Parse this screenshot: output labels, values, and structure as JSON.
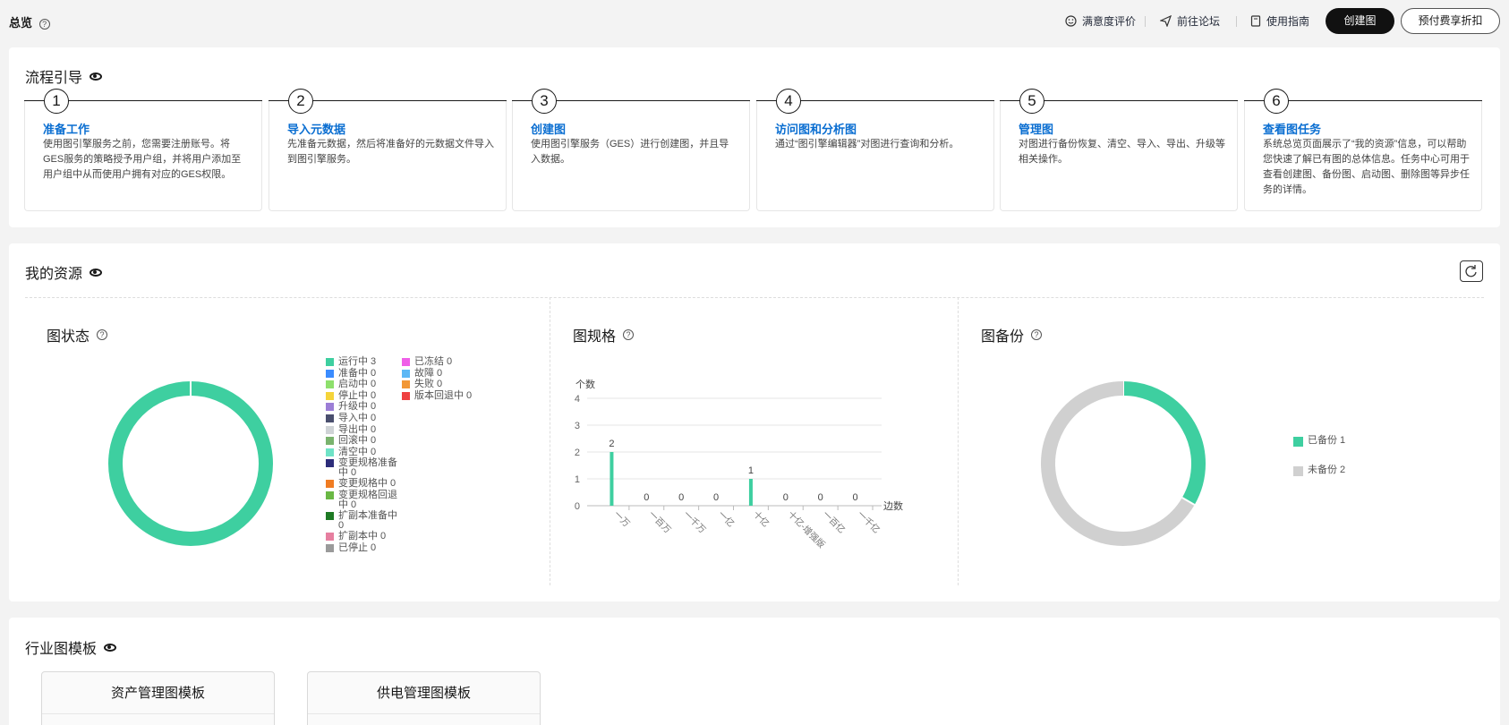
{
  "header": {
    "title": "总览",
    "links": [
      "满意度评价",
      "前往论坛",
      "使用指南"
    ],
    "create_button": "创建图",
    "discount_button": "预付费享折扣"
  },
  "guide": {
    "title": "流程引导",
    "steps": [
      {
        "num": "1",
        "title": "准备工作",
        "desc": "使用图引擎服务之前，您需要注册账号。将GES服务的策略授予用户组，并将用户添加至用户组中从而使用户拥有对应的GES权限。"
      },
      {
        "num": "2",
        "title": "导入元数据",
        "desc": "先准备元数据，然后将准备好的元数据文件导入到图引擎服务。"
      },
      {
        "num": "3",
        "title": "创建图",
        "desc": "使用图引擎服务（GES）进行创建图，并且导入数据。"
      },
      {
        "num": "4",
        "title": "访问图和分析图",
        "desc": "通过“图引擎编辑器”对图进行查询和分析。"
      },
      {
        "num": "5",
        "title": "管理图",
        "desc": "对图进行备份恢复、清空、导入、导出、升级等相关操作。"
      },
      {
        "num": "6",
        "title": "查看图任务",
        "desc": "系统总览页面展示了“我的资源”信息，可以帮助您快速了解已有图的总体信息。任务中心可用于查看创建图、备份图、启动图、删除图等异步任务的详情。"
      }
    ]
  },
  "resources": {
    "title": "我的资源",
    "status": {
      "title": "图状态",
      "legend_left": [
        {
          "label": "运行中",
          "value": "3",
          "color": "#3ecfa0"
        },
        {
          "label": "准备中",
          "value": "0",
          "color": "#3b8cff"
        },
        {
          "label": "启动中",
          "value": "0",
          "color": "#8ee06c"
        },
        {
          "label": "停止中",
          "value": "0",
          "color": "#f5d43a"
        },
        {
          "label": "升级中",
          "value": "0",
          "color": "#9c7ed6"
        },
        {
          "label": "导入中",
          "value": "0",
          "color": "#4a4f6e"
        },
        {
          "label": "导出中",
          "value": "0",
          "color": "#cfd3d6"
        },
        {
          "label": "回滚中",
          "value": "0",
          "color": "#7ab36d"
        },
        {
          "label": "清空中",
          "value": "0",
          "color": "#6fe3c7"
        },
        {
          "label": "变更规格准备中",
          "value": "0",
          "color": "#2d2d7a"
        },
        {
          "label": "变更规格中",
          "value": "0",
          "color": "#f07c22"
        },
        {
          "label": "变更规格回退中",
          "value": "0",
          "color": "#6ab844"
        },
        {
          "label": "扩副本准备中",
          "value": "0",
          "color": "#1e7a24"
        },
        {
          "label": "扩副本中",
          "value": "0",
          "color": "#e67fa0"
        },
        {
          "label": "已停止",
          "value": "0",
          "color": "#9a9a9a"
        }
      ],
      "legend_right": [
        {
          "label": "已冻结",
          "value": "0",
          "color": "#ef5fe8"
        },
        {
          "label": "故障",
          "value": "0",
          "color": "#5db8f5"
        },
        {
          "label": "失败",
          "value": "0",
          "color": "#f29735"
        },
        {
          "label": "版本回退中",
          "value": "0",
          "color": "#ef4141"
        }
      ]
    },
    "spec": {
      "title": "图规格"
    },
    "backup": {
      "title": "图备份",
      "legend": [
        {
          "label": "已备份 1",
          "color": "#3ecfa0"
        },
        {
          "label": "未备份 2",
          "color": "#d0d0d0"
        }
      ]
    }
  },
  "chart_data": [
    {
      "type": "pie",
      "title": "图状态",
      "donut": true,
      "slices": [
        {
          "name": "运行中",
          "value": 3,
          "color": "#3ecfa0"
        }
      ]
    },
    {
      "type": "bar",
      "title": "图规格",
      "ylabel": "个数",
      "xlabel": "边数",
      "categories": [
        "一万",
        "一百万",
        "一千万",
        "一亿",
        "十亿",
        "十亿-增强版",
        "一百亿",
        "一千亿"
      ],
      "values": [
        2,
        0,
        0,
        0,
        1,
        0,
        0,
        0
      ],
      "ylim": [
        0,
        4
      ],
      "yticks": [
        0,
        1,
        2,
        3,
        4
      ],
      "color": "#3ecfa0",
      "grid": true
    },
    {
      "type": "pie",
      "title": "图备份",
      "donut": true,
      "slices": [
        {
          "name": "已备份",
          "value": 1,
          "color": "#3ecfa0"
        },
        {
          "name": "未备份",
          "value": 2,
          "color": "#d0d0d0"
        }
      ],
      "legend": "right"
    }
  ],
  "templates": {
    "title": "行业图模板",
    "cards": [
      "资产管理图模板",
      "供电管理图模板"
    ]
  }
}
